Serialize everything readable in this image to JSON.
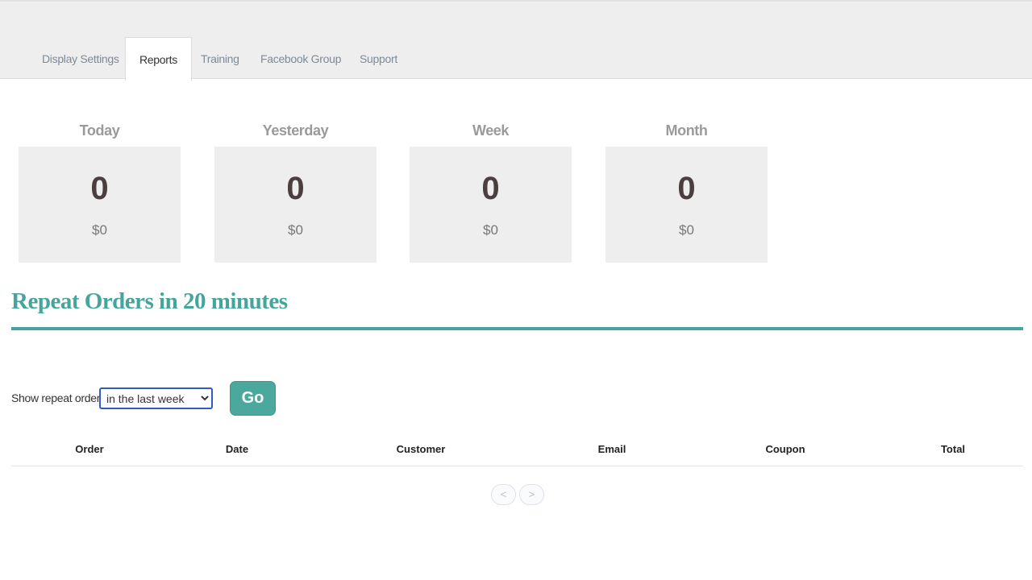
{
  "tabs": [
    {
      "label": "Display Settings"
    },
    {
      "label": "Reports",
      "active": true
    },
    {
      "label": "Training"
    },
    {
      "label": "Facebook Group"
    },
    {
      "label": "Support"
    }
  ],
  "stats": [
    {
      "label": "Today",
      "count": "0",
      "amount": "$0"
    },
    {
      "label": "Yesterday",
      "count": "0",
      "amount": "$0"
    },
    {
      "label": "Week",
      "count": "0",
      "amount": "$0"
    },
    {
      "label": "Month",
      "count": "0",
      "amount": "$0"
    }
  ],
  "section": {
    "title": "Repeat Orders in 20 minutes"
  },
  "filter": {
    "label": "Show repeat orders",
    "selected": "in the last week",
    "go_label": "Go"
  },
  "table": {
    "headers": [
      "Order",
      "Date",
      "Customer",
      "Email",
      "Coupon",
      "Total"
    ]
  },
  "pager": {
    "prev": "<",
    "next": ">"
  },
  "colors": {
    "accent": "#45a59a",
    "button": "#4aa89c"
  }
}
